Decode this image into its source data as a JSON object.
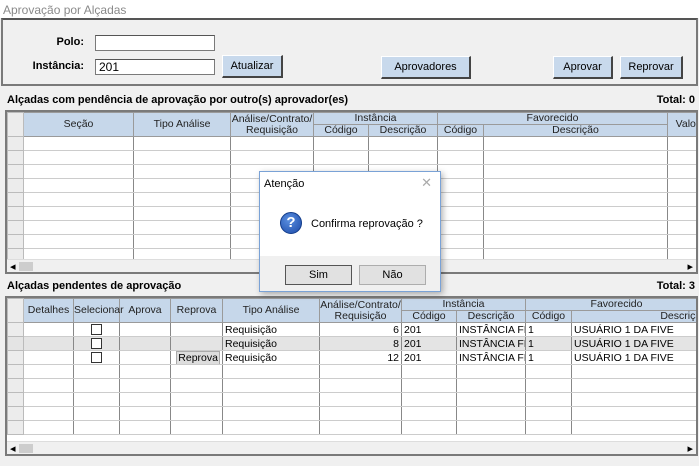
{
  "window": {
    "title": "Aprovação por Alçadas"
  },
  "filters": {
    "polo_label": "Polo:",
    "polo_value": "",
    "instancia_label": "Instância:",
    "instancia_value": "201"
  },
  "toolbar": {
    "atualizar": "Atualizar",
    "aprovadores": "Aprovadores",
    "aprovar": "Aprovar",
    "reprovar": "Reprovar"
  },
  "grid1": {
    "title": "Alçadas com pendência de aprovação por outro(s) aprovador(es)",
    "total": "Total: 0",
    "headers": {
      "secao": "Seção",
      "tipo": "Tipo Análise",
      "analise": "Análise/Contrato/ Requisição",
      "instancia": "Instância",
      "inst_codigo": "Código",
      "inst_desc": "Descrição",
      "favorecido": "Favorecido",
      "fav_codigo": "Código",
      "fav_desc": "Descrição",
      "valor": "Valor"
    }
  },
  "grid2": {
    "title": "Alçadas pendentes de aprovação",
    "total": "Total: 3",
    "headers": {
      "detalhes": "Detalhes",
      "selecionar": "Selecionar",
      "aprova": "Aprova",
      "reprova": "Reprova",
      "tipo": "Tipo Análise",
      "analise": "Análise/Contrato/ Requisição",
      "instancia": "Instância",
      "inst_codigo": "Código",
      "inst_desc": "Descrição",
      "favorecido": "Favorecido",
      "fav_codigo": "Código",
      "fav_desc": "Descrição"
    },
    "rows": [
      {
        "reprova": "",
        "tipo": "Requisição",
        "analise": "6",
        "inst_codigo": "201",
        "inst_desc": "INSTÂNCIA FIVE",
        "fav_codigo": "1",
        "fav_desc": "USUÁRIO 1 DA FIVE"
      },
      {
        "reprova": "",
        "tipo": "Requisição",
        "analise": "8",
        "inst_codigo": "201",
        "inst_desc": "INSTÂNCIA FIVE",
        "fav_codigo": "1",
        "fav_desc": "USUÁRIO 1 DA FIVE"
      },
      {
        "reprova": "Reprova",
        "tipo": "Requisição",
        "analise": "12",
        "inst_codigo": "201",
        "inst_desc": "INSTÂNCIA FIVE",
        "fav_codigo": "1",
        "fav_desc": "USUÁRIO 1 DA FIVE"
      }
    ]
  },
  "dialog": {
    "title": "Atenção",
    "message": "Confirma reprovação ?",
    "yes": "Sim",
    "no": "Não",
    "icon": "question-icon"
  }
}
